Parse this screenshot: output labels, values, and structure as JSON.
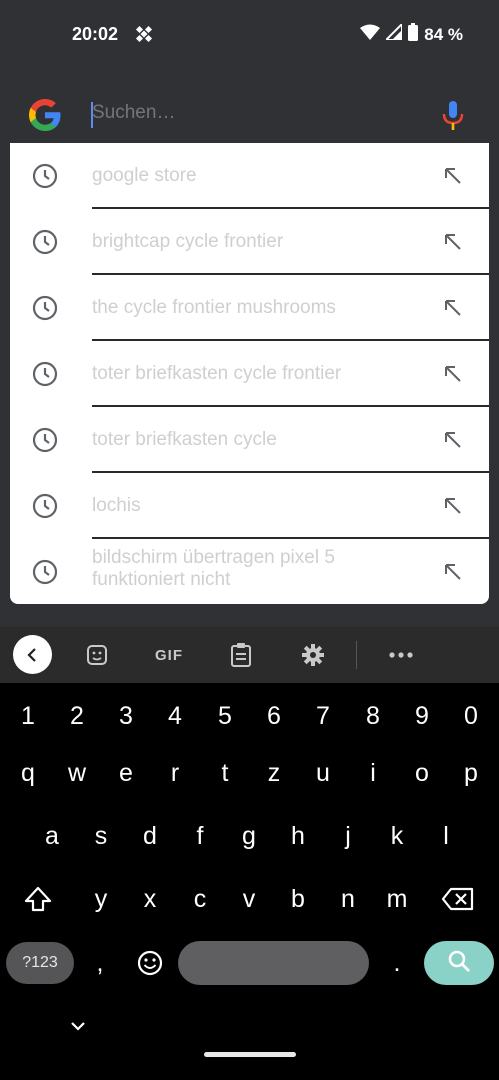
{
  "status_bar": {
    "time": "20:02",
    "battery": "84 %",
    "icons": [
      "notification-icon",
      "wifi-icon",
      "signal-icon",
      "battery-icon"
    ]
  },
  "search": {
    "placeholder": "Suchen…",
    "value": "",
    "logo": "google-logo",
    "voice_icon": "mic-icon"
  },
  "suggestions": [
    {
      "text": "google store"
    },
    {
      "text": "brightcap cycle frontier"
    },
    {
      "text": "the cycle frontier mushrooms"
    },
    {
      "text": "toter briefkasten cycle frontier"
    },
    {
      "text": "toter briefkasten cycle"
    },
    {
      "text": "lochis"
    },
    {
      "text": "bildschirm übertragen pixel 5 funktioniert nicht"
    }
  ],
  "keyboard_toolbar": {
    "gif_label": "GIF",
    "icons": [
      "back-chevron-icon",
      "sticker-icon",
      "gif-icon",
      "clipboard-icon",
      "settings-icon",
      "more-icon"
    ]
  },
  "keyboard": {
    "row_numbers": [
      "1",
      "2",
      "3",
      "4",
      "5",
      "6",
      "7",
      "8",
      "9",
      "0"
    ],
    "row1": [
      "q",
      "w",
      "e",
      "r",
      "t",
      "z",
      "u",
      "i",
      "o",
      "p"
    ],
    "row2": [
      "a",
      "s",
      "d",
      "f",
      "g",
      "h",
      "j",
      "k",
      "l"
    ],
    "row3": [
      "y",
      "x",
      "c",
      "v",
      "b",
      "n",
      "m"
    ],
    "symbols_label": "?123",
    "comma": ",",
    "period": ".",
    "colors": {
      "search_key": "#8ad1c7",
      "space_key": "#5f5f61",
      "background": "#000000"
    }
  },
  "colors": {
    "top_area": "#303134",
    "suggestion_text": "#cfcfcf",
    "placeholder": "#7a7d82"
  }
}
